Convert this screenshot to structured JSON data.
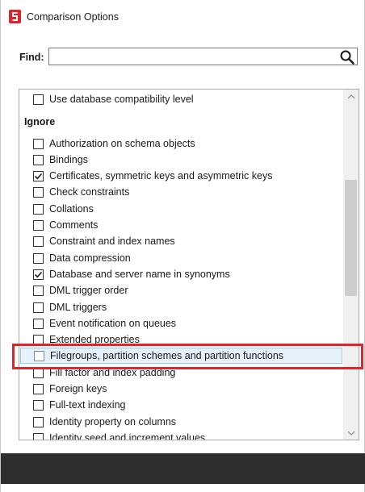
{
  "window": {
    "title": "Comparison Options"
  },
  "find": {
    "label": "Find:",
    "value": "",
    "placeholder": ""
  },
  "options": {
    "top_item": {
      "label": "Use database compatibility level",
      "checked": false
    },
    "section_title": "Ignore",
    "items": [
      {
        "label": "Authorization on schema objects",
        "checked": false
      },
      {
        "label": "Bindings",
        "checked": false
      },
      {
        "label": "Certificates, symmetric keys and asymmetric keys",
        "checked": true
      },
      {
        "label": "Check constraints",
        "checked": false
      },
      {
        "label": "Collations",
        "checked": false
      },
      {
        "label": "Comments",
        "checked": false
      },
      {
        "label": "Constraint and index names",
        "checked": false
      },
      {
        "label": "Data compression",
        "checked": false
      },
      {
        "label": "Database and server name in synonyms",
        "checked": true
      },
      {
        "label": "DML trigger order",
        "checked": false
      },
      {
        "label": "DML triggers",
        "checked": false
      },
      {
        "label": "Event notification on queues",
        "checked": false
      },
      {
        "label": "Extended properties",
        "checked": false
      },
      {
        "label": "Filegroups, partition schemes and partition functions",
        "checked": false,
        "selected": true
      },
      {
        "label": "Fill factor and index padding",
        "checked": false
      },
      {
        "label": "Foreign keys",
        "checked": false
      },
      {
        "label": "Full-text indexing",
        "checked": false
      },
      {
        "label": "Identity property on columns",
        "checked": false
      },
      {
        "label": "Identity seed and increment values",
        "checked": false
      }
    ]
  },
  "icons": {
    "app": "redgate-logo-icon",
    "search": "search-icon",
    "scroll_up": "chevron-up-icon",
    "scroll_down": "chevron-down-icon",
    "check": "checkmark-icon"
  },
  "colors": {
    "brand_red": "#e0242b",
    "selection_bg": "#e5f1fb",
    "selection_border": "#99c9ef",
    "footer_bg": "#2e2e2e"
  }
}
